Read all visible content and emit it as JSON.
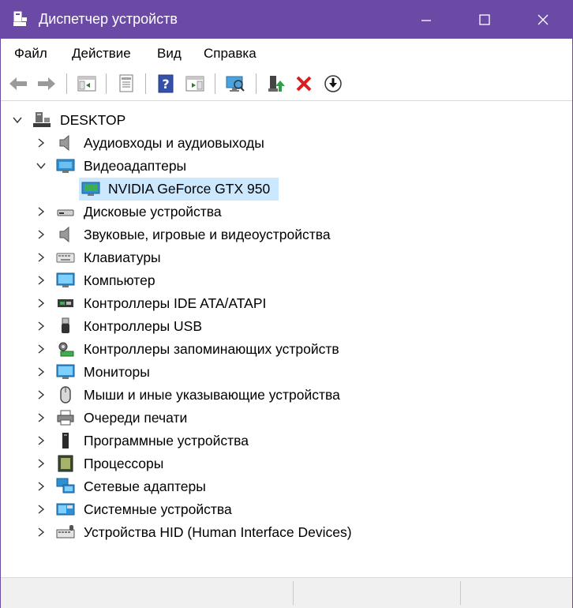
{
  "window": {
    "title": "Диспетчер устройств",
    "accent": "#6b4aa6"
  },
  "menu": [
    {
      "label": "Файл"
    },
    {
      "label": "Действие"
    },
    {
      "label": "Вид"
    },
    {
      "label": "Справка"
    }
  ],
  "toolbar": {
    "buttons": [
      {
        "name": "back-arrow-icon"
      },
      {
        "name": "forward-arrow-icon"
      },
      {
        "name": "show-hide-console-tree-icon"
      },
      {
        "name": "properties-icon"
      },
      {
        "name": "help-icon"
      },
      {
        "name": "action-pane-icon"
      },
      {
        "name": "scan-hardware-changes-icon"
      },
      {
        "name": "update-driver-icon"
      },
      {
        "name": "uninstall-device-icon"
      },
      {
        "name": "download-icon"
      }
    ]
  },
  "tree": {
    "root": "DESKTOP",
    "items": [
      {
        "label": "Аудиовходы и аудиовыходы",
        "icon": "speaker-icon",
        "expanded": false
      },
      {
        "label": "Видеоадаптеры",
        "icon": "display-adapter-icon",
        "expanded": true
      },
      {
        "label": "NVIDIA GeForce GTX 950",
        "icon": "video-card-icon",
        "child": true,
        "selected": true
      },
      {
        "label": "Дисковые устройства",
        "icon": "disk-drive-icon",
        "expanded": false
      },
      {
        "label": "Звуковые, игровые и видеоустройства",
        "icon": "sound-icon",
        "expanded": false
      },
      {
        "label": "Клавиатуры",
        "icon": "keyboard-icon",
        "expanded": false
      },
      {
        "label": "Компьютер",
        "icon": "computer-icon",
        "expanded": false
      },
      {
        "label": "Контроллеры IDE ATA/ATAPI",
        "icon": "ide-controller-icon",
        "expanded": false
      },
      {
        "label": "Контроллеры USB",
        "icon": "usb-icon",
        "expanded": false
      },
      {
        "label": "Контроллеры запоминающих устройств",
        "icon": "storage-controller-icon",
        "expanded": false
      },
      {
        "label": "Мониторы",
        "icon": "monitor-icon",
        "expanded": false
      },
      {
        "label": "Мыши и иные указывающие устройства",
        "icon": "mouse-icon",
        "expanded": false
      },
      {
        "label": "Очереди печати",
        "icon": "printer-icon",
        "expanded": false
      },
      {
        "label": "Программные устройства",
        "icon": "software-device-icon",
        "expanded": false
      },
      {
        "label": "Процессоры",
        "icon": "processor-icon",
        "expanded": false
      },
      {
        "label": "Сетевые адаптеры",
        "icon": "network-adapter-icon",
        "expanded": false
      },
      {
        "label": "Системные устройства",
        "icon": "system-device-icon",
        "expanded": false
      },
      {
        "label": "Устройства HID (Human Interface Devices)",
        "icon": "hid-icon",
        "expanded": false
      }
    ]
  }
}
